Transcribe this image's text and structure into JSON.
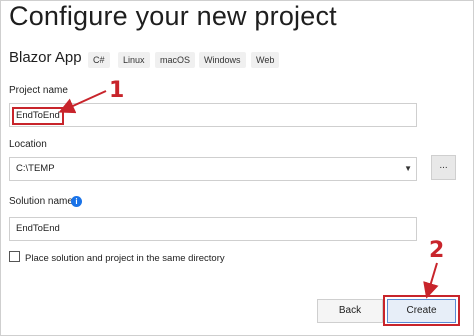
{
  "window": {
    "title": "Configure your new project"
  },
  "template": {
    "name": "Blazor App",
    "tags": [
      "C#",
      "Linux",
      "macOS",
      "Windows",
      "Web"
    ]
  },
  "form": {
    "project_name_label": "Project name",
    "project_name_value": "EndToEnd",
    "location_label": "Location",
    "location_value": "C:\\TEMP",
    "browse_label": "...",
    "solution_name_label": "Solution name",
    "solution_name_value": "EndToEnd",
    "same_dir_checkbox_label": "Place solution and project in the same directory",
    "same_dir_checked": false
  },
  "buttons": {
    "back": "Back",
    "create": "Create"
  },
  "annotations": {
    "callout_1": "1",
    "callout_2": "2",
    "accent": "#c8242b"
  },
  "icons": {
    "info": "info-icon",
    "dropdown": "chevron-down-icon"
  }
}
